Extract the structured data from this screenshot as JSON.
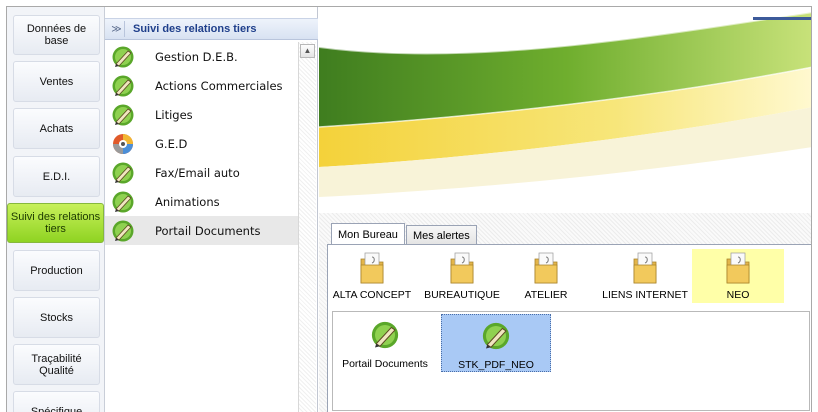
{
  "nav": {
    "items": [
      {
        "label": "Données de base",
        "active": false
      },
      {
        "label": "Ventes",
        "active": false
      },
      {
        "label": "Achats",
        "active": false
      },
      {
        "label": "E.D.I.",
        "active": false
      },
      {
        "label": "Suivi des relations tiers",
        "active": true
      },
      {
        "label": "Production",
        "active": false
      },
      {
        "label": "Stocks",
        "active": false
      },
      {
        "label": "Traçabilité Qualité",
        "active": false
      },
      {
        "label": "Spécifique",
        "active": false
      }
    ]
  },
  "menu": {
    "title": "Suivi des relations tiers",
    "collapse_glyph": "≫",
    "items": [
      {
        "label": "Gestion D.E.B.",
        "icon": "pencil-check-icon"
      },
      {
        "label": "Actions Commerciales",
        "icon": "pencil-check-icon"
      },
      {
        "label": "Litiges",
        "icon": "pencil-check-icon"
      },
      {
        "label": "G.E.D",
        "icon": "colorful-disc-icon"
      },
      {
        "label": "Fax/Email auto",
        "icon": "pencil-check-icon"
      },
      {
        "label": "Animations",
        "icon": "pencil-check-icon"
      },
      {
        "label": "Portail Documents",
        "icon": "pencil-check-icon"
      }
    ],
    "selected_index": 6
  },
  "bureau": {
    "tabs": [
      {
        "label": "Mon Bureau",
        "active": true
      },
      {
        "label": "Mes alertes",
        "active": false
      }
    ],
    "folders": [
      {
        "label": "ALTA CONCEPT",
        "highlighted": false
      },
      {
        "label": "BUREAUTIQUE",
        "highlighted": false
      },
      {
        "label": "ATELIER",
        "highlighted": false
      },
      {
        "label": "LIENS INTERNET",
        "highlighted": false
      },
      {
        "label": "NEO",
        "highlighted": true
      }
    ],
    "documents": [
      {
        "label": "Portail Documents",
        "selected": false
      },
      {
        "label": "STK_PDF_NEO",
        "selected": true
      }
    ]
  },
  "colors": {
    "accent": "#1f3f8b",
    "active_nav": "#8fd322",
    "folder_highlight": "#ffffa8",
    "doc_selected": "#a9c9f5"
  }
}
